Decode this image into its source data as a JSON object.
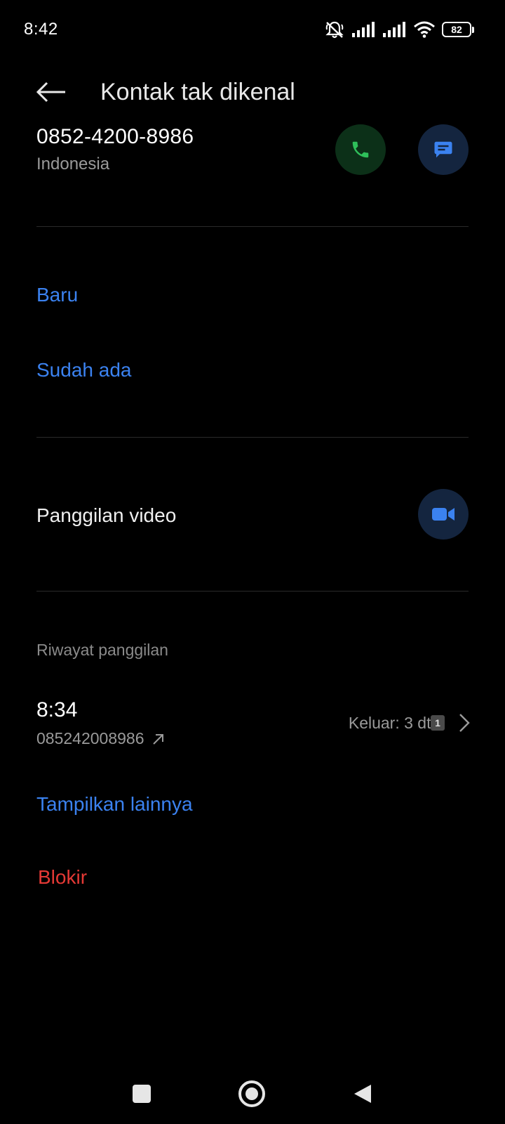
{
  "status_bar": {
    "time": "8:42",
    "battery": "82"
  },
  "header": {
    "title": "Kontak tak dikenal"
  },
  "contact": {
    "number": "0852-4200-8986",
    "region": "Indonesia"
  },
  "add_options": {
    "new_label": "Baru",
    "existing_label": "Sudah ada"
  },
  "video_call": {
    "label": "Panggilan video"
  },
  "history": {
    "heading": "Riwayat panggilan",
    "entries": [
      {
        "time": "8:34",
        "number": "085242008986",
        "detail": "Keluar: 3 dtk",
        "sim": "1"
      }
    ]
  },
  "show_more_label": "Tampilkan lainnya",
  "block_label": "Blokir",
  "colors": {
    "accent_blue": "#3b82f0",
    "call_green": "#2fbf5a",
    "danger_red": "#e53935"
  }
}
